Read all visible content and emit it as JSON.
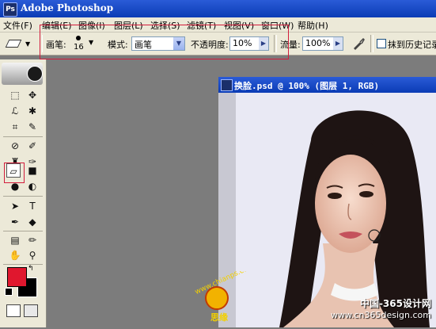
{
  "app": {
    "title": "Adobe Photoshop",
    "icon_text": "Ps"
  },
  "menu": [
    {
      "label": "文件(F)",
      "id": "file"
    },
    {
      "label": "编辑(E)",
      "id": "edit"
    },
    {
      "label": "图像(I)",
      "id": "image"
    },
    {
      "label": "图层(L)",
      "id": "layer"
    },
    {
      "label": "选择(S)",
      "id": "select"
    },
    {
      "label": "滤镜(T)",
      "id": "filter"
    },
    {
      "label": "视图(V)",
      "id": "view"
    },
    {
      "label": "窗口(W)",
      "id": "window"
    },
    {
      "label": "帮助(H)",
      "id": "help"
    }
  ],
  "options": {
    "brush_label": "画笔:",
    "brush_size": "16",
    "mode_label": "模式:",
    "mode_value": "画笔",
    "opacity_label": "不透明度:",
    "opacity_value": "10%",
    "flow_label": "流量:",
    "flow_value": "100%",
    "history_label": "抹到历史记录"
  },
  "document": {
    "title": "换脸.psd @ 100% (图层 1, RGB)"
  },
  "colors": {
    "foreground": "#e0172e",
    "background": "#000000",
    "titlebar": "#0b3cb5"
  },
  "watermarks": {
    "logo_text": "www.chianps.com",
    "logo_sub": "思缘",
    "site_cn": "中国-365设计网",
    "site_url": "www.cn365design.com"
  },
  "toolbox_icons": [
    "marquee-icon",
    "move-icon",
    "lasso-icon",
    "magic-wand-icon",
    "crop-icon",
    "slice-icon",
    "healing-brush-icon",
    "brush-icon",
    "clone-stamp-icon",
    "history-brush-icon",
    "eraser-icon",
    "gradient-icon",
    "blur-icon",
    "dodge-icon",
    "path-selection-icon",
    "type-icon",
    "pen-icon",
    "shape-icon",
    "notes-icon",
    "eyedropper-icon",
    "hand-icon",
    "zoom-icon"
  ]
}
